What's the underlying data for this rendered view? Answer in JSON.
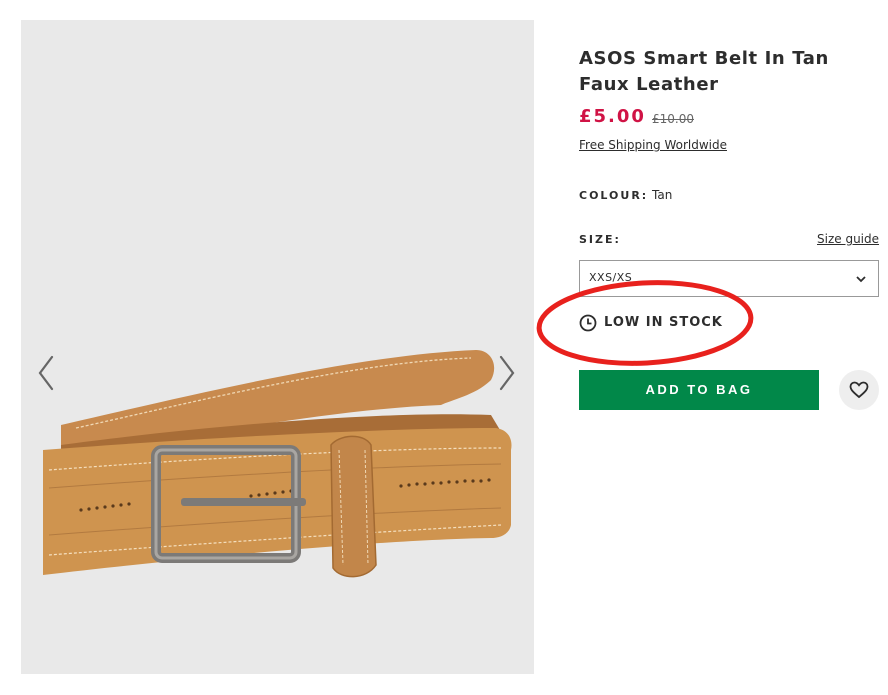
{
  "product": {
    "title": "ASOS Smart Belt In Tan Faux Leather",
    "price_now": "£5.00",
    "price_was": "£10.00",
    "shipping_link": "Free Shipping Worldwide",
    "colour_label": "COLOUR:",
    "colour_value": "Tan",
    "size_label": "SIZE:",
    "size_guide": "Size guide",
    "size_selected": "XXS/XS",
    "stock_status": "LOW IN STOCK",
    "add_to_bag": "ADD TO BAG"
  },
  "icons": {
    "prev": "chevron-left-icon",
    "next": "chevron-right-icon",
    "select": "chevron-down-icon",
    "stock": "clock-icon",
    "save": "heart-icon"
  },
  "colors": {
    "price": "#d01345",
    "add_to_bag": "#018849",
    "highlight": "#e8211d"
  }
}
